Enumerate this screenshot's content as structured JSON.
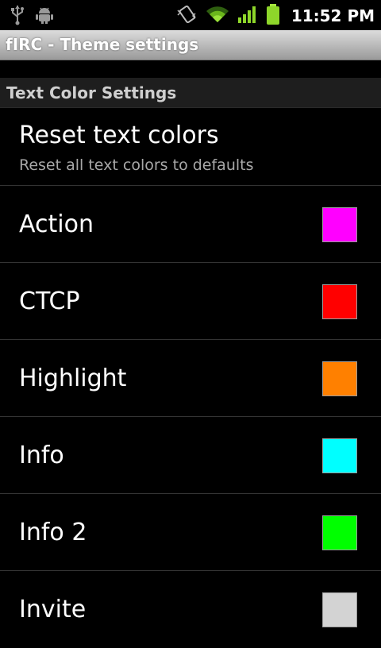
{
  "status_bar": {
    "icons": [
      "usb-icon",
      "android-debug-icon",
      "vibrate-icon",
      "wifi-icon",
      "signal-icon",
      "battery-icon"
    ],
    "time": "11:52 PM"
  },
  "title_bar": {
    "title": "fIRC - Theme settings"
  },
  "section": {
    "title": "Text Color Settings"
  },
  "reset": {
    "title": "Reset text colors",
    "summary": "Reset all text colors to defaults"
  },
  "colors": [
    {
      "label": "Action",
      "color": "#ff00ff"
    },
    {
      "label": "CTCP",
      "color": "#ff0000"
    },
    {
      "label": "Highlight",
      "color": "#ff8000"
    },
    {
      "label": "Info",
      "color": "#00ffff"
    },
    {
      "label": "Info 2",
      "color": "#00ff00"
    },
    {
      "label": "Invite",
      "color": "#d3d3d3"
    }
  ]
}
